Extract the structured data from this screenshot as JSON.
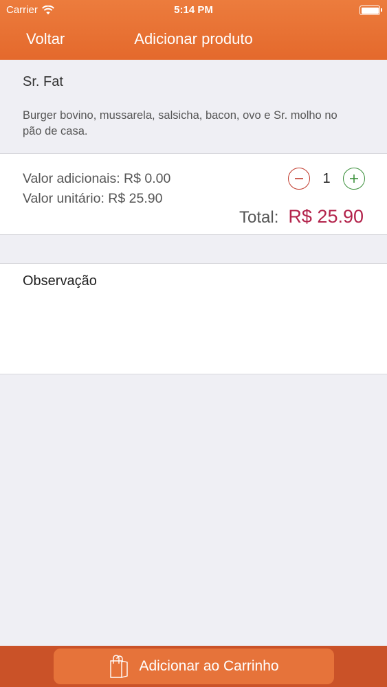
{
  "status_bar": {
    "carrier": "Carrier",
    "time": "5:14 PM"
  },
  "nav": {
    "back_label": "Voltar",
    "title": "Adicionar produto"
  },
  "product": {
    "name": "Sr. Fat",
    "description": "Burger bovino, mussarela, salsicha, bacon, ovo e Sr. molho no pão de casa."
  },
  "pricing": {
    "additional_line": "Valor adicionais: R$ 0.00",
    "unit_line": "Valor unitário: R$ 25.90",
    "quantity": "1",
    "total_label": "Total:",
    "total_value": "R$ 25.90"
  },
  "observation": {
    "label": "Observação",
    "value": ""
  },
  "footer": {
    "add_to_cart_label": "Adicionar ao Carrinho"
  },
  "colors": {
    "brand_orange": "#e8712f",
    "bottom_bar": "#ca5228",
    "total_red": "#b3234b",
    "minus_red": "#c0392b",
    "plus_green": "#3a8f3a"
  },
  "icons": {
    "wifi": "wifi-icon",
    "battery": "battery-icon",
    "minus": "minus-circle-icon",
    "plus": "plus-circle-icon",
    "bag": "shopping-bag-icon"
  }
}
